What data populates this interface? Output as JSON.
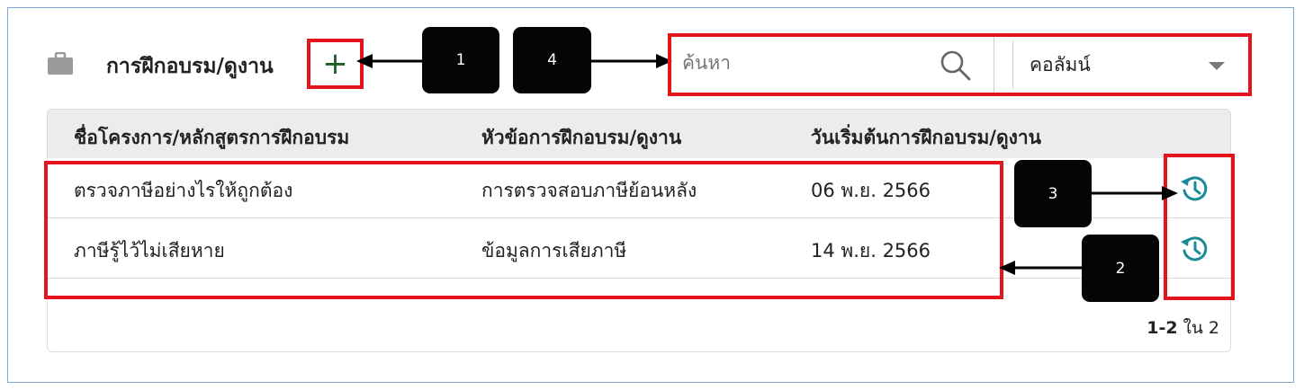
{
  "section": {
    "title": "การฝึกอบรม/ดูงาน",
    "add_label": "+"
  },
  "callouts": [
    "1",
    "2",
    "3",
    "4"
  ],
  "search": {
    "placeholder": "ค้นหา",
    "column_select": "คอลัมน์"
  },
  "table": {
    "headers": [
      "ชื่อโครงการ/หลักสูตรการฝึกอบรม",
      "หัวข้อการฝึกอบรม/ดูงาน",
      "วันเริ่มต้นการฝึกอบรม/ดูงาน"
    ],
    "rows": [
      {
        "course": "ตรวจภาษีอย่างไรให้ถูกต้อง",
        "topic": "การตรวจสอบภาษีย้อนหลัง",
        "start_date": "06 พ.ย. 2566"
      },
      {
        "course": "ภาษีรู้ไว้ไม่เสียหาย",
        "topic": "ข้อมูลการเสียภาษี",
        "start_date": "14 พ.ย. 2566"
      }
    ]
  },
  "pagination": {
    "range": "1-2",
    "of_label": " ใน ",
    "total": "2"
  },
  "colors": {
    "annotation_red": "#e3141b",
    "accent_teal": "#1a8a96",
    "add_green": "#1d5e27",
    "frame_blue": "#7fa6cf"
  },
  "icons": {
    "section": "briefcase-icon",
    "search": "search-icon",
    "history": "history-icon"
  }
}
